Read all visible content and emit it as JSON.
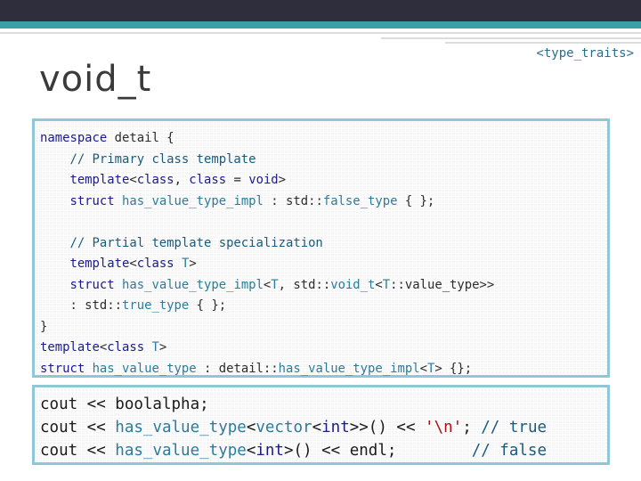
{
  "slide": {
    "title": "void_t",
    "header_tag": "<type_traits>"
  },
  "code": {
    "lines": [
      [
        {
          "t": "kw",
          "v": "namespace"
        },
        {
          "t": "tx",
          "v": " detail {"
        }
      ],
      [
        {
          "t": "tx",
          "v": "    "
        },
        {
          "t": "cm",
          "v": "// Primary class template"
        }
      ],
      [
        {
          "t": "tx",
          "v": "    "
        },
        {
          "t": "kw",
          "v": "template"
        },
        {
          "t": "tx",
          "v": "<"
        },
        {
          "t": "kw",
          "v": "class"
        },
        {
          "t": "tx",
          "v": ", "
        },
        {
          "t": "kw",
          "v": "class"
        },
        {
          "t": "tx",
          "v": " = "
        },
        {
          "t": "kw",
          "v": "void"
        },
        {
          "t": "tx",
          "v": ">"
        }
      ],
      [
        {
          "t": "tx",
          "v": "    "
        },
        {
          "t": "kw",
          "v": "struct"
        },
        {
          "t": "tx",
          "v": " "
        },
        {
          "t": "ty",
          "v": "has_value_type_impl"
        },
        {
          "t": "tx",
          "v": " : std::"
        },
        {
          "t": "ty",
          "v": "false_type"
        },
        {
          "t": "tx",
          "v": " { };"
        }
      ],
      [
        {
          "t": "tx",
          "v": ""
        }
      ],
      [
        {
          "t": "tx",
          "v": "    "
        },
        {
          "t": "cm",
          "v": "// Partial template specialization"
        }
      ],
      [
        {
          "t": "tx",
          "v": "    "
        },
        {
          "t": "kw",
          "v": "template"
        },
        {
          "t": "tx",
          "v": "<"
        },
        {
          "t": "kw",
          "v": "class"
        },
        {
          "t": "tx",
          "v": " "
        },
        {
          "t": "tp",
          "v": "T"
        },
        {
          "t": "tx",
          "v": ">"
        }
      ],
      [
        {
          "t": "tx",
          "v": "    "
        },
        {
          "t": "kw",
          "v": "struct"
        },
        {
          "t": "tx",
          "v": " "
        },
        {
          "t": "ty",
          "v": "has_value_type_impl"
        },
        {
          "t": "tx",
          "v": "<"
        },
        {
          "t": "tp",
          "v": "T"
        },
        {
          "t": "tx",
          "v": ", std::"
        },
        {
          "t": "ty",
          "v": "void_t"
        },
        {
          "t": "tx",
          "v": "<"
        },
        {
          "t": "tp",
          "v": "T"
        },
        {
          "t": "tx",
          "v": "::value_type>>"
        }
      ],
      [
        {
          "t": "tx",
          "v": "    : std::"
        },
        {
          "t": "ty",
          "v": "true_type"
        },
        {
          "t": "tx",
          "v": " { };"
        }
      ],
      [
        {
          "t": "tx",
          "v": "}"
        }
      ],
      [
        {
          "t": "kw",
          "v": "template"
        },
        {
          "t": "tx",
          "v": "<"
        },
        {
          "t": "kw",
          "v": "class"
        },
        {
          "t": "tx",
          "v": " "
        },
        {
          "t": "tp",
          "v": "T"
        },
        {
          "t": "tx",
          "v": ">"
        }
      ],
      [
        {
          "t": "kw",
          "v": "struct"
        },
        {
          "t": "tx",
          "v": " "
        },
        {
          "t": "ty",
          "v": "has_value_type"
        },
        {
          "t": "tx",
          "v": " : detail::"
        },
        {
          "t": "ty",
          "v": "has_value_type_impl"
        },
        {
          "t": "tx",
          "v": "<"
        },
        {
          "t": "tp",
          "v": "T"
        },
        {
          "t": "tx",
          "v": "> {};"
        }
      ]
    ]
  },
  "usage": {
    "lines": [
      [
        {
          "t": "tx",
          "v": "cout << boolalpha;"
        }
      ],
      [
        {
          "t": "tx",
          "v": "cout << "
        },
        {
          "t": "ty",
          "v": "has_value_type"
        },
        {
          "t": "tx",
          "v": "<"
        },
        {
          "t": "ty",
          "v": "vector"
        },
        {
          "t": "tx",
          "v": "<"
        },
        {
          "t": "kw",
          "v": "int"
        },
        {
          "t": "tx",
          "v": ">>() << "
        },
        {
          "t": "st",
          "v": "'\\n'"
        },
        {
          "t": "tx",
          "v": "; "
        },
        {
          "t": "cm",
          "v": "// true"
        }
      ],
      [
        {
          "t": "tx",
          "v": "cout << "
        },
        {
          "t": "ty",
          "v": "has_value_type"
        },
        {
          "t": "tx",
          "v": "<"
        },
        {
          "t": "kw",
          "v": "int"
        },
        {
          "t": "tx",
          "v": ">() << endl;        "
        },
        {
          "t": "cm",
          "v": "// false"
        }
      ]
    ]
  }
}
